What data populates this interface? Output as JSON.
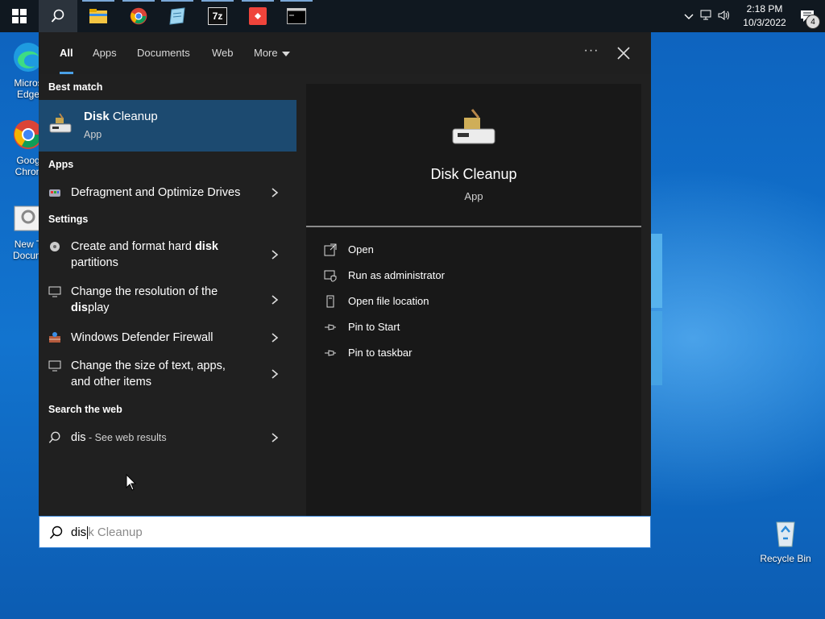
{
  "taskbar": {
    "clock_time": "2:18 PM",
    "clock_date": "10/3/2022",
    "notification_count": "4",
    "apps": [
      "file-explorer-icon",
      "chrome-icon",
      "notepad-icon",
      "7zip-icon",
      "anydesk-icon",
      "terminal-icon"
    ],
    "sevenzip_label": "7z"
  },
  "desktop": {
    "icons": [
      {
        "label": "Micros\nEdge"
      },
      {
        "label": "Goog\nChron"
      },
      {
        "label": "New T\nDocum"
      },
      {
        "label": "Recycle Bin"
      }
    ]
  },
  "search": {
    "tabs": [
      "All",
      "Apps",
      "Documents",
      "Web",
      "More"
    ],
    "sections": {
      "best_match": "Best match",
      "apps": "Apps",
      "settings": "Settings",
      "web": "Search the web"
    },
    "best_match": {
      "title_bold": "Disk",
      "title_rest": " Cleanup",
      "subtitle": "App"
    },
    "apps": [
      {
        "label": "Defragment and Optimize Drives"
      }
    ],
    "settings": [
      {
        "pre": "Create and format hard ",
        "bold": "disk",
        "post": "",
        "line2": "partitions"
      },
      {
        "pre": "Change the resolution of the",
        "bold": "dis",
        "post": "play",
        "line2": ""
      },
      {
        "pre": "Windows Defender Firewall",
        "bold": "",
        "post": "",
        "line2": ""
      },
      {
        "pre": "Change the size of text, apps,",
        "bold": "",
        "post": "",
        "line2": "and other items"
      }
    ],
    "web": {
      "query": "dis",
      "suffix": " - See web results"
    },
    "preview": {
      "title": "Disk Cleanup",
      "subtitle": "App"
    },
    "actions": [
      "Open",
      "Run as administrator",
      "Open file location",
      "Pin to Start",
      "Pin to taskbar"
    ],
    "input": {
      "typed": "dis",
      "suggestion": "k Cleanup"
    }
  },
  "colors": {
    "accent": "#4aa0e6",
    "selected": "#1c4a70"
  }
}
